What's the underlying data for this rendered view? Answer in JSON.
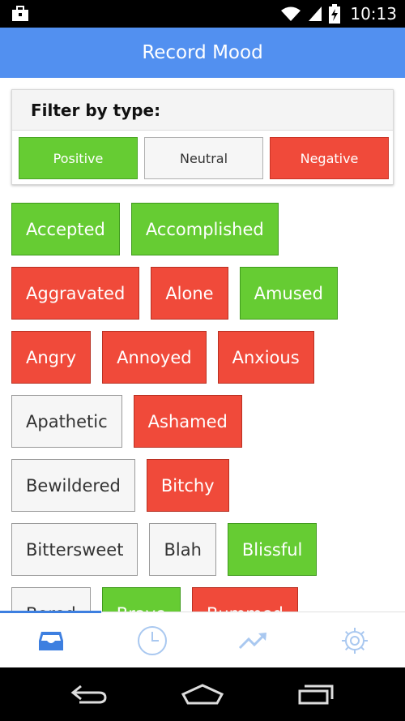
{
  "status_bar": {
    "time": "10:13",
    "icons": [
      "briefcase-icon",
      "wifi-icon",
      "signal-icon",
      "battery-charging-icon"
    ]
  },
  "app_bar": {
    "title": "Record Mood"
  },
  "filter": {
    "label": "Filter by type:",
    "buttons": [
      {
        "label": "Positive",
        "type": "positive"
      },
      {
        "label": "Neutral",
        "type": "neutral"
      },
      {
        "label": "Negative",
        "type": "negative"
      }
    ]
  },
  "moods": {
    "rows": [
      [
        {
          "label": "Accepted",
          "type": "positive"
        },
        {
          "label": "Accomplished",
          "type": "positive"
        }
      ],
      [
        {
          "label": "Aggravated",
          "type": "negative"
        },
        {
          "label": "Alone",
          "type": "negative"
        },
        {
          "label": "Amused",
          "type": "positive"
        }
      ],
      [
        {
          "label": "Angry",
          "type": "negative"
        },
        {
          "label": "Annoyed",
          "type": "negative"
        },
        {
          "label": "Anxious",
          "type": "negative"
        }
      ],
      [
        {
          "label": "Apathetic",
          "type": "neutral"
        },
        {
          "label": "Ashamed",
          "type": "negative"
        }
      ],
      [
        {
          "label": "Bewildered",
          "type": "neutral"
        },
        {
          "label": "Bitchy",
          "type": "negative"
        }
      ],
      [
        {
          "label": "Bittersweet",
          "type": "neutral"
        },
        {
          "label": "Blah",
          "type": "neutral"
        },
        {
          "label": "Blissful",
          "type": "positive"
        }
      ],
      [
        {
          "label": "Bored",
          "type": "neutral"
        },
        {
          "label": "Brave",
          "type": "positive"
        },
        {
          "label": "Bummed",
          "type": "negative"
        }
      ]
    ]
  },
  "tabs": [
    {
      "icon": "inbox-icon",
      "active": true
    },
    {
      "icon": "clock-icon",
      "active": false
    },
    {
      "icon": "trend-icon",
      "active": false
    },
    {
      "icon": "gear-icon",
      "active": false
    }
  ],
  "nav": {
    "icons": [
      "back-icon",
      "home-icon",
      "recents-icon"
    ]
  },
  "colors": {
    "accent": "#5290f0",
    "positive": "#66cc33",
    "negative": "#f04a3a",
    "neutral": "#f6f6f6",
    "tab_active": "#3d7fe0",
    "tab_inactive": "#a9c8f0"
  }
}
